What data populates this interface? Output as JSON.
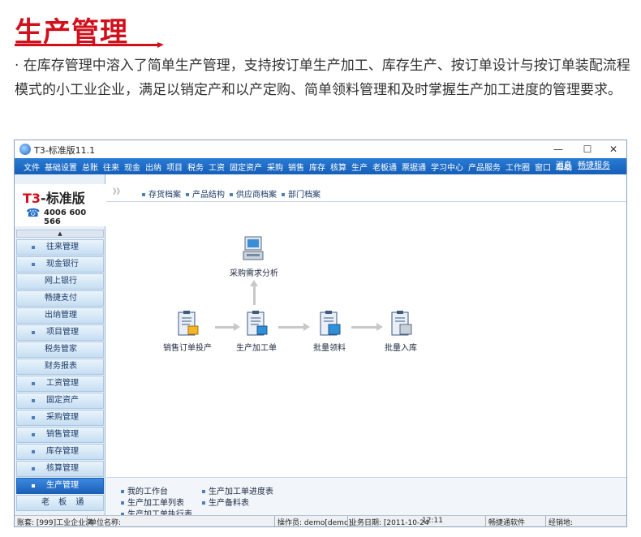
{
  "header": {
    "title": "生产管理",
    "description": "· 在库存管理中溶入了简单生产管理，支持按订单生产加工、库存生产、按订单设计与按订单装配流程模式的小工业企业，满足以销定产和以产定购、简单领料管理和及时掌握生产加工进度的管理要求。"
  },
  "window": {
    "title": "T3-标准版11.1",
    "controls": {
      "minimize": "—",
      "maximize": "☐",
      "close": "✕"
    }
  },
  "menubar": {
    "items": [
      "文件",
      "基础设置",
      "总账",
      "往来",
      "现金",
      "出纳",
      "项目",
      "税务",
      "工资",
      "固定资产",
      "采购",
      "销售",
      "库存",
      "核算",
      "生产",
      "老板通",
      "票据通",
      "学习中心",
      "产品服务",
      "工作圈",
      "窗口",
      "帮助"
    ],
    "right": {
      "messages": "消息",
      "service": "畅捷服务"
    }
  },
  "sidebar": {
    "brand_prefix": "T3",
    "brand_suffix": "-标准版",
    "phone": "4006 600 566",
    "items": [
      {
        "label": "往来管理",
        "type": "sub"
      },
      {
        "label": "现金银行",
        "type": "sub"
      },
      {
        "label": "网上银行",
        "type": "plain2"
      },
      {
        "label": "畅捷支付",
        "type": "plain2"
      },
      {
        "label": "出纳管理",
        "type": "plain2"
      },
      {
        "label": "项目管理",
        "type": "sub"
      },
      {
        "label": "税务管家",
        "type": "plain2"
      },
      {
        "label": "财务报表",
        "type": "plain2"
      },
      {
        "label": "工资管理",
        "type": "sub"
      },
      {
        "label": "固定资产",
        "type": "sub"
      },
      {
        "label": "采购管理",
        "type": "sub"
      },
      {
        "label": "销售管理",
        "type": "sub"
      },
      {
        "label": "库存管理",
        "type": "sub"
      },
      {
        "label": "核算管理",
        "type": "sub"
      },
      {
        "label": "生产管理",
        "type": "active"
      },
      {
        "label": "老 板 通",
        "type": "plain"
      }
    ]
  },
  "main": {
    "toptabs": [
      "存货档案",
      "产品结构",
      "供应商档案",
      "部门档案"
    ],
    "toptab_arrow": "》》",
    "nodes": {
      "purchase_analysis": "采购需求分析",
      "sales_order_production": "销售订单投产",
      "production_order": "生产加工单",
      "batch_material": "批量领料",
      "batch_inbound": "批量入库"
    },
    "bottom_links": [
      "我的工作台",
      "生产加工单进度表",
      "生产加工单列表",
      "生产备料表",
      "生产加工单执行表"
    ]
  },
  "statusbar": {
    "account": "账套: [999]工业企业演",
    "unit": "单位名称:",
    "operator": "操作员: demo[demo]",
    "date": "业务日期: [2011-10-24",
    "time": "12:11",
    "software": "畅捷通软件",
    "dealer": "经销地:"
  }
}
